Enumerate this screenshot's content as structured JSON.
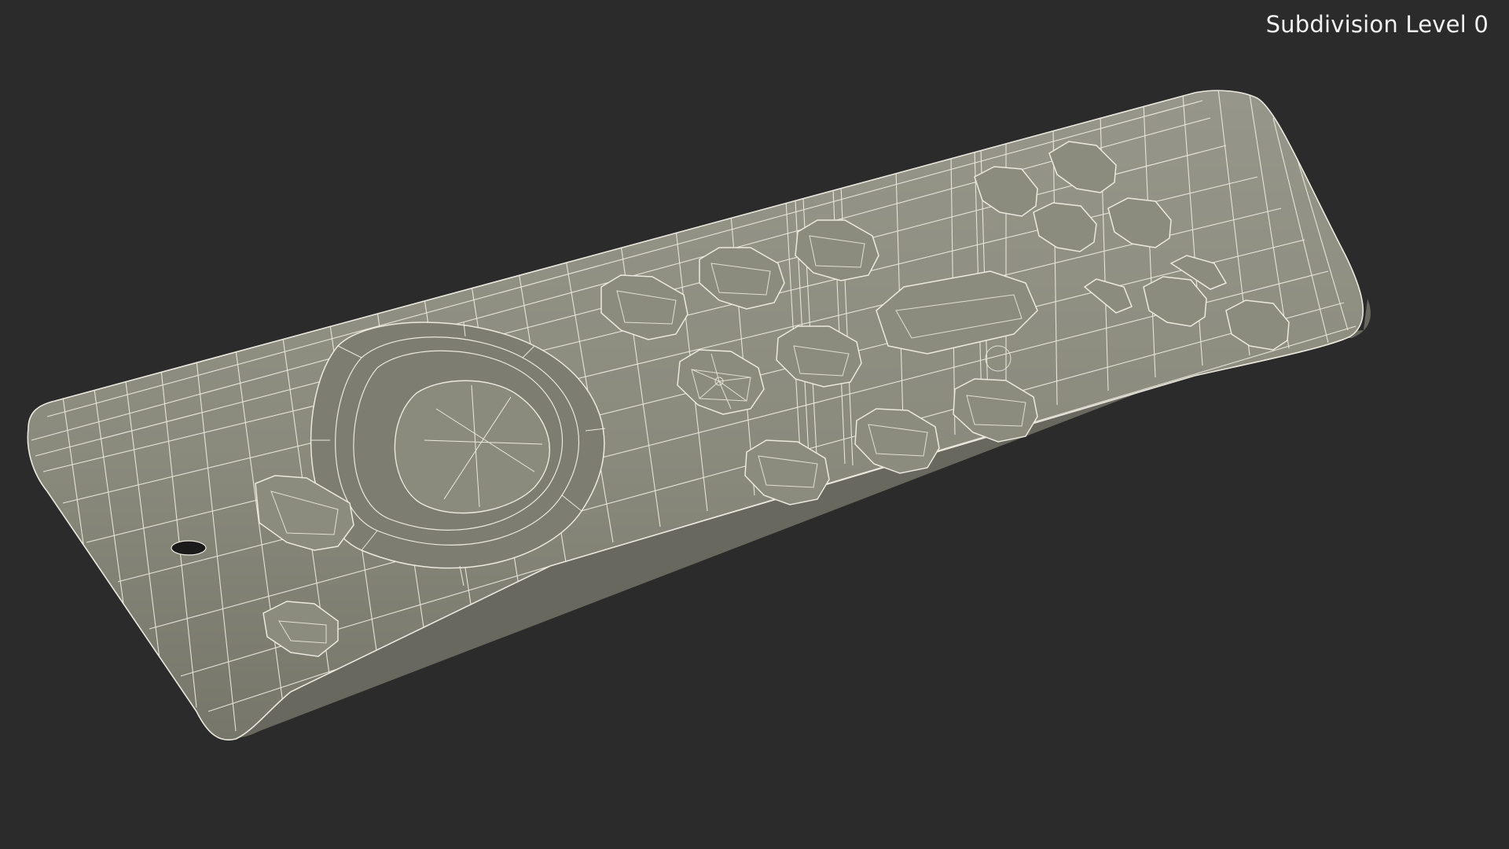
{
  "viewport": {
    "label": "Subdivision Level 0",
    "background_color": "#2b2b2b",
    "label_color": "#f2f2f2"
  },
  "model": {
    "subject": "remote-control-wireframe",
    "surface_color": "#8a8a7c",
    "wire_color": "#ece9df",
    "shadow_color": "#5f5f55"
  }
}
